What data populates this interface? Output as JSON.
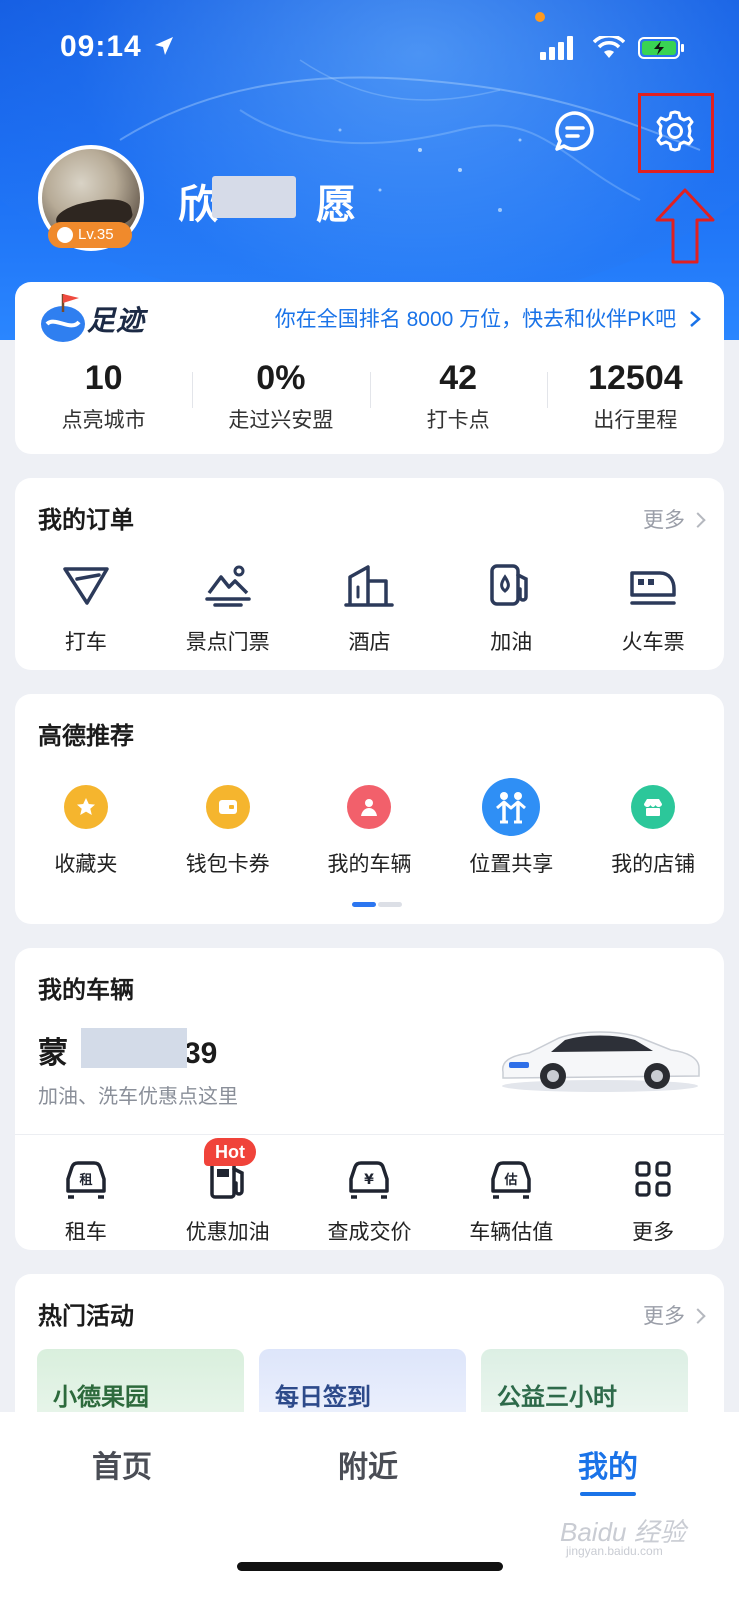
{
  "status_bar": {
    "time": "09:14"
  },
  "profile": {
    "username": "欣",
    "username_tail": "愿",
    "level": "Lv.35"
  },
  "footprint": {
    "title": "足迹",
    "rank_text": "你在全国排名 8000 万位，快去和伙伴PK吧",
    "stats": [
      {
        "value": "10",
        "label": "点亮城市"
      },
      {
        "value": "0%",
        "label": "走过兴安盟"
      },
      {
        "value": "42",
        "label": "打卡点"
      },
      {
        "value": "12504",
        "label": "出行里程"
      }
    ]
  },
  "orders": {
    "title": "我的订单",
    "more": "更多",
    "items": [
      {
        "label": "打车",
        "icon": "taxi-icon"
      },
      {
        "label": "景点门票",
        "icon": "scenic-ticket-icon"
      },
      {
        "label": "酒店",
        "icon": "hotel-icon"
      },
      {
        "label": "加油",
        "icon": "fuel-icon"
      },
      {
        "label": "火车票",
        "icon": "train-icon"
      }
    ]
  },
  "recommend": {
    "title": "高德推荐",
    "items": [
      {
        "label": "收藏夹",
        "icon": "favorites-icon",
        "color": "#f5b52e"
      },
      {
        "label": "钱包卡券",
        "icon": "wallet-icon",
        "color": "#f5b52e"
      },
      {
        "label": "我的车辆",
        "icon": "my-vehicle-icon",
        "color": "#f2606b"
      },
      {
        "label": "位置共享",
        "icon": "location-share-icon",
        "color": "#2f8ff5"
      },
      {
        "label": "我的店铺",
        "icon": "my-store-icon",
        "color": "#2cc79a"
      }
    ]
  },
  "vehicle": {
    "title": "我的车辆",
    "plate_prefix": "蒙",
    "plate_suffix": "39",
    "subtitle": "加油、洗车优惠点这里",
    "actions": [
      {
        "label": "租车",
        "icon": "rent-car-icon"
      },
      {
        "label": "优惠加油",
        "icon": "discount-fuel-icon",
        "badge": "Hot"
      },
      {
        "label": "查成交价",
        "icon": "price-check-icon"
      },
      {
        "label": "车辆估值",
        "icon": "valuation-icon"
      },
      {
        "label": "更多",
        "icon": "more-grid-icon"
      }
    ]
  },
  "activities": {
    "title": "热门活动",
    "more": "更多",
    "tiles": [
      {
        "label": "小德果园",
        "color": "#e3f3e6",
        "text_color": "#2d6a3c"
      },
      {
        "label": "每日签到",
        "color": "#e7ecfb",
        "text_color": "#2d4a8a"
      },
      {
        "label": "公益三小时",
        "color": "#e6f2ec",
        "text_color": "#2d6a4a"
      }
    ]
  },
  "tabbar": {
    "tabs": [
      {
        "label": "首页"
      },
      {
        "label": "附近"
      },
      {
        "label": "我的",
        "active": true
      }
    ]
  },
  "watermark": {
    "brand": "Baidu 经验",
    "domain": "jingyan.baidu.com"
  },
  "colors": {
    "primary": "#1a73e8",
    "header": "#1a6cf2",
    "highlight": "#e02020",
    "hot": "#f0433a"
  }
}
